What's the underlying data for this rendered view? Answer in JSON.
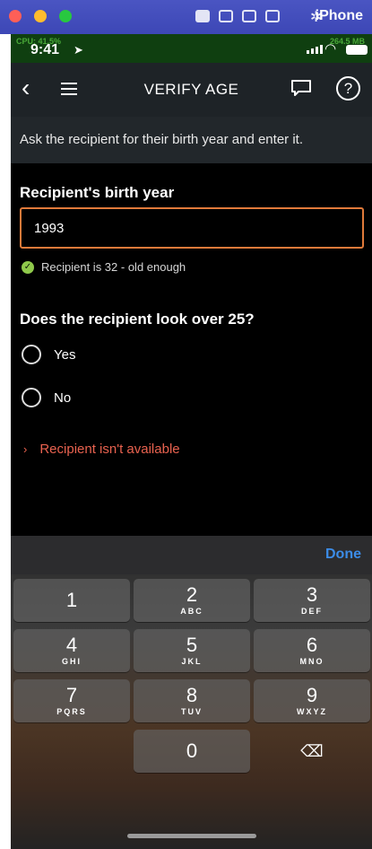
{
  "mac_bar": {
    "title": "iPhone",
    "window_controls": [
      "close",
      "minimize",
      "zoom"
    ],
    "tool_icons": [
      "camera-icon",
      "video-icon",
      "headphones-icon",
      "screen-icon"
    ],
    "settings_icon": "gear-icon"
  },
  "status_bar": {
    "time": "9:41",
    "cpu_overlay": "CPU: 41.5%",
    "mem_overlay": "264.5 MB",
    "location_icon": "arrow",
    "colors": {
      "overlay_text": "#78ff5a",
      "status_bg": "#0f3f10"
    }
  },
  "navbar": {
    "title": "VERIFY AGE",
    "back_icon": "chevron-left",
    "menu_icon": "hamburger",
    "chat_icon": "chat-bubble",
    "help_icon": "?"
  },
  "instruction": "Ask the recipient for their birth year and enter it.",
  "birth_year": {
    "label": "Recipient's birth year",
    "value": "1993",
    "border_color": "#e07a3a"
  },
  "validation": {
    "icon": "✓",
    "text": "Recipient is 32 - old enough",
    "color": "#8fc94b"
  },
  "question": {
    "title": "Does the recipient look over 25?",
    "options": [
      {
        "label": "Yes",
        "selected": false
      },
      {
        "label": "No",
        "selected": false
      }
    ]
  },
  "unavailable_link": {
    "chevron": "›",
    "label": "Recipient isn't available",
    "color": "#e8624f"
  },
  "keyboard": {
    "done_label": "Done",
    "keys": [
      {
        "num": "1",
        "letters": ""
      },
      {
        "num": "2",
        "letters": "ABC"
      },
      {
        "num": "3",
        "letters": "DEF"
      },
      {
        "num": "4",
        "letters": "GHI"
      },
      {
        "num": "5",
        "letters": "JKL"
      },
      {
        "num": "6",
        "letters": "MNO"
      },
      {
        "num": "7",
        "letters": "PQRS"
      },
      {
        "num": "8",
        "letters": "TUV"
      },
      {
        "num": "9",
        "letters": "WXYZ"
      },
      {
        "num": "0",
        "letters": ""
      }
    ],
    "delete_glyph": "⌫"
  }
}
